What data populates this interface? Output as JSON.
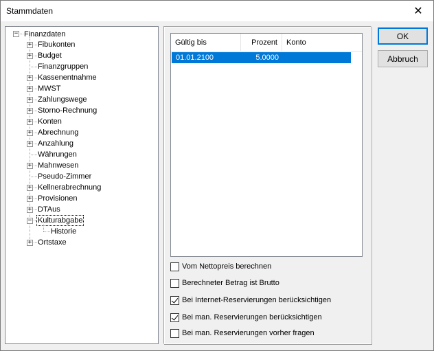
{
  "window": {
    "title": "Stammdaten",
    "close_glyph": "✕"
  },
  "tree": {
    "root": {
      "label": "Finanzdaten",
      "expander": "−"
    },
    "items": [
      {
        "label": "Fibukonten",
        "expander": "+"
      },
      {
        "label": "Budget",
        "expander": "+"
      },
      {
        "label": "Finanzgruppen",
        "expander": ""
      },
      {
        "label": "Kassenentnahme",
        "expander": "+"
      },
      {
        "label": "MWST",
        "expander": "+"
      },
      {
        "label": "Zahlungswege",
        "expander": "+"
      },
      {
        "label": "Storno-Rechnung",
        "expander": "+"
      },
      {
        "label": "Konten",
        "expander": "+"
      },
      {
        "label": "Abrechnung",
        "expander": "+"
      },
      {
        "label": "Anzahlung",
        "expander": "+"
      },
      {
        "label": "Währungen",
        "expander": ""
      },
      {
        "label": "Mahnwesen",
        "expander": "+"
      },
      {
        "label": "Pseudo-Zimmer",
        "expander": ""
      },
      {
        "label": "Kellnerabrechnung",
        "expander": "+"
      },
      {
        "label": "Provisionen",
        "expander": "+"
      },
      {
        "label": "DTAus",
        "expander": "+"
      },
      {
        "label": "Kulturabgabe",
        "expander": "−",
        "selected": true
      },
      {
        "label": "Historie",
        "expander": "",
        "child": true
      },
      {
        "label": "Ortstaxe",
        "expander": "+"
      }
    ]
  },
  "grid": {
    "columns": [
      "Gültig bis",
      "Prozent",
      "Konto"
    ],
    "rows": [
      {
        "gueltig_bis": "01.01.2100",
        "prozent": "5.0000",
        "konto": ""
      }
    ]
  },
  "options": [
    {
      "label": "Vom Nettopreis berechnen",
      "checked": false
    },
    {
      "label": "Berechneter Betrag ist Brutto",
      "checked": false
    },
    {
      "label": "Bei Internet-Reservierungen berücksichtigen",
      "checked": true
    },
    {
      "label": "Bei man. Reservierungen berücksichtigen",
      "checked": true
    },
    {
      "label": "Bei man. Reservierungen vorher fragen",
      "checked": false
    }
  ],
  "buttons": {
    "ok": "OK",
    "cancel": "Abbruch"
  }
}
